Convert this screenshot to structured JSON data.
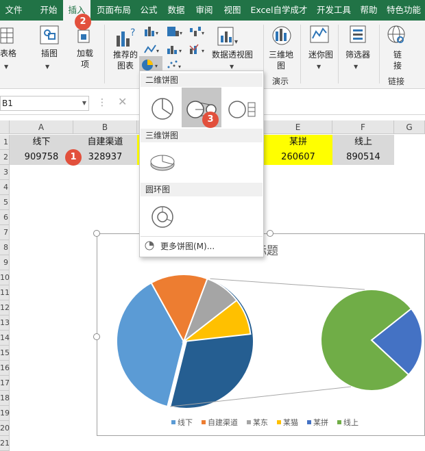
{
  "menubar": {
    "tabs": [
      "文件",
      "开始",
      "插入",
      "页面布局",
      "公式",
      "数据",
      "审阅",
      "视图",
      "Excel自学成才",
      "开发工具",
      "帮助",
      "特色功能"
    ],
    "active_tab": "插入"
  },
  "ribbon": {
    "table_label": "表格",
    "illustrations_label": "插图",
    "addins_label": "加载\n项",
    "recommended_label": "推荐的\n图表",
    "pivotchart_label": "数据透视图",
    "map3d_label": "三维地\n图",
    "sparkline_label": "迷你图",
    "slicer_label": "筛选器",
    "link_label": "链\n接",
    "group_demo": "演示",
    "group_link": "链接"
  },
  "formula_bar": {
    "name_box": "B1",
    "cancel": "✕"
  },
  "columns": [
    "A",
    "B",
    "C",
    "D",
    "E",
    "F",
    "G"
  ],
  "rows": [
    "1",
    "2",
    "3",
    "4",
    "5",
    "6",
    "7",
    "8",
    "9",
    "10",
    "11",
    "12",
    "13",
    "14",
    "15",
    "16",
    "17",
    "18",
    "19",
    "20",
    "21"
  ],
  "cells": {
    "a1": "线下",
    "b1": "自建渠道",
    "e1": "某拼",
    "f1": "线上",
    "a2": "909758",
    "b2": "328937",
    "e2": "260607",
    "f2": "890514"
  },
  "badges": [
    "1",
    "2",
    "3"
  ],
  "dropdown": {
    "section_2d": "二维饼图",
    "section_3d": "三维饼图",
    "section_donut": "圆环图",
    "more": "更多饼图(M)..."
  },
  "chart_data": {
    "type": "pie",
    "title": "图表标题",
    "categories": [
      "线下",
      "自建渠道",
      "某东",
      "某猫",
      "某拼",
      "线上"
    ],
    "values": [
      909758,
      328937,
      0,
      0,
      260607,
      890514
    ],
    "colors": [
      "#5b9bd5",
      "#ed7d31",
      "#a5a5a5",
      "#ffc000",
      "#4472c4",
      "#70ad47"
    ],
    "legend_position": "bottom",
    "note": "pie of pie; secondary pie shows 某拼 and 线上"
  }
}
